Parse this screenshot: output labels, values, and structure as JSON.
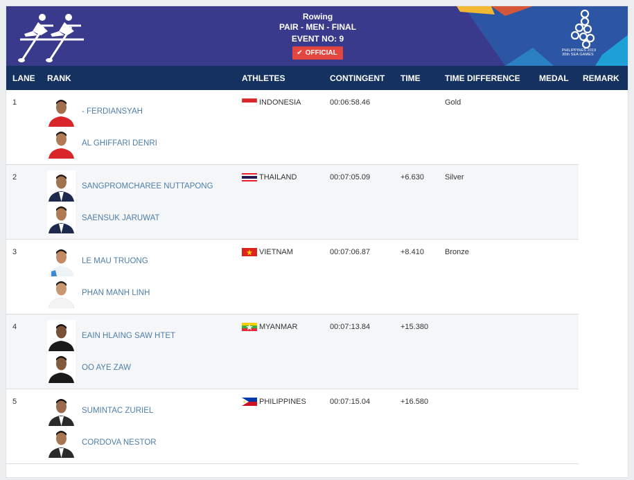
{
  "event": {
    "sport": "Rowing",
    "name": "PAIR - MEN - FINAL",
    "number": "EVENT NO: 9",
    "status": "OFFICIAL",
    "brand_text_1": "PHILIPPINES 2019",
    "brand_text_2": "30th SEA GAMES"
  },
  "columns": {
    "lane": "LANE",
    "rank": "RANK",
    "athletes": "ATHLETES",
    "contingent": "CONTINGENT",
    "time": "TIME",
    "time_difference": "TIME DIFFERENCE",
    "medal": "MEDAL",
    "remark": "REMARK"
  },
  "colors": {
    "banner": "#3a3a8c",
    "header": "#14315f",
    "official": "#e2463e",
    "athlete_link": "#4d7fa9"
  },
  "results": [
    {
      "lane": "1",
      "athletes": [
        "- FERDIANSYAH",
        "AL GHIFFARI DENRI"
      ],
      "contingent": "INDONESIA",
      "flag": "indonesia-flag",
      "time": "00:06:58.46",
      "time_difference": "",
      "medal": "Gold"
    },
    {
      "lane": "2",
      "athletes": [
        "SANGPROMCHAREE NUTTAPONG",
        "SAENSUK JARUWAT"
      ],
      "contingent": "THAILAND",
      "flag": "thailand-flag",
      "time": "00:07:05.09",
      "time_difference": "+6.630",
      "medal": "Silver"
    },
    {
      "lane": "3",
      "athletes": [
        "LE MAU TRUONG",
        "PHAN MANH LINH"
      ],
      "contingent": "VIETNAM",
      "flag": "vietnam-flag",
      "time": "00:07:06.87",
      "time_difference": "+8.410",
      "medal": "Bronze"
    },
    {
      "lane": "4",
      "athletes": [
        "EAIN HLAING SAW HTET",
        "OO AYE ZAW"
      ],
      "contingent": "MYANMAR",
      "flag": "myanmar-flag",
      "time": "00:07:13.84",
      "time_difference": "+15.380",
      "medal": ""
    },
    {
      "lane": "5",
      "athletes": [
        "SUMINTAC ZURIEL",
        "CORDOVA NESTOR"
      ],
      "contingent": "PHILIPPINES",
      "flag": "philippines-flag",
      "time": "00:07:15.04",
      "time_difference": "+16.580",
      "medal": ""
    }
  ]
}
